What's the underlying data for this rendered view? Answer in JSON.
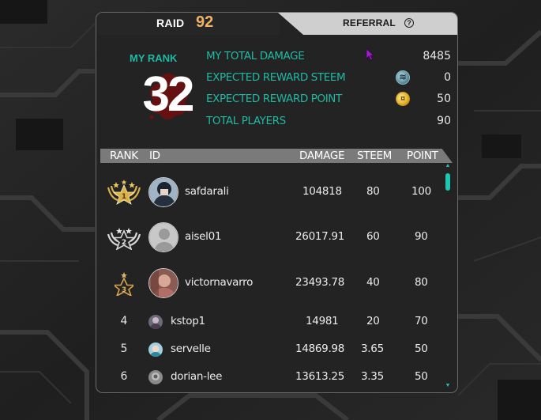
{
  "tabs": {
    "raid_label": "RAID",
    "raid_number": "92",
    "referral_label": "REFERRAL",
    "help_glyph": "?"
  },
  "summary": {
    "my_rank_label": "MY RANK",
    "my_rank_value": "32",
    "stats": [
      {
        "label": "MY TOTAL DAMAGE",
        "value": "8485",
        "icon": ""
      },
      {
        "label": "EXPECTED REWARD STEEM",
        "value": "0",
        "icon": "steem-coin-icon"
      },
      {
        "label": "EXPECTED REWARD POINT",
        "value": "50",
        "icon": "point-coin-icon"
      },
      {
        "label": "TOTAL PLAYERS",
        "value": "90",
        "icon": ""
      }
    ]
  },
  "table": {
    "headers": {
      "rank": "RANK",
      "id": "ID",
      "damage": "DAMAGE",
      "steem": "STEEM",
      "point": "POINT"
    },
    "rows": [
      {
        "rank": "1",
        "id": "safdarali",
        "damage": "104818",
        "steem": "80",
        "point": "100",
        "badge": "gold-rank-badge-icon"
      },
      {
        "rank": "2",
        "id": "aisel01",
        "damage": "26017.91",
        "steem": "60",
        "point": "90",
        "badge": "silver-rank-badge-icon"
      },
      {
        "rank": "3",
        "id": "victornavarro",
        "damage": "23493.78",
        "steem": "40",
        "point": "80",
        "badge": "bronze-rank-badge-icon"
      },
      {
        "rank": "4",
        "id": "kstop1",
        "damage": "14981",
        "steem": "20",
        "point": "70"
      },
      {
        "rank": "5",
        "id": "servelle",
        "damage": "14869.98",
        "steem": "3.65",
        "point": "50"
      },
      {
        "rank": "6",
        "id": "dorian-lee",
        "damage": "13613.25",
        "steem": "3.35",
        "point": "50"
      }
    ]
  },
  "colors": {
    "accent_teal": "#1fb9a4",
    "raid_orange": "#f0b264",
    "gold": "#d8b34a",
    "silver": "#d9d9d9",
    "bronze": "#d7a44f"
  }
}
